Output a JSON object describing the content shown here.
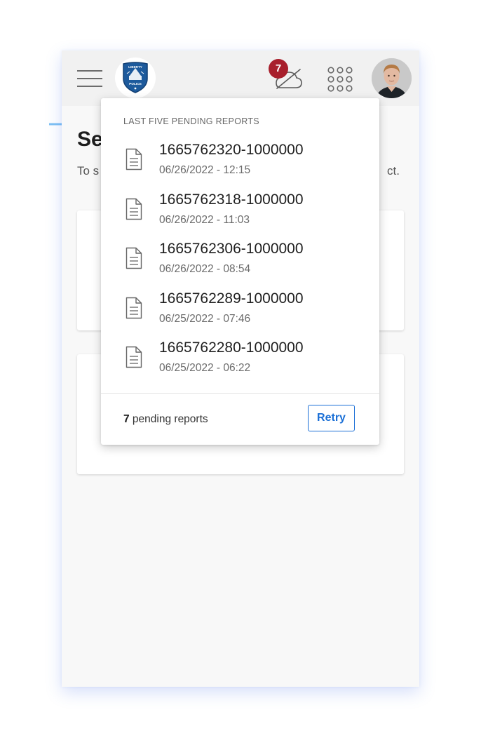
{
  "header": {
    "menu_icon": "hamburger-menu-icon",
    "logo": {
      "top_text": "LIBERTY",
      "bottom_text": "POLICE",
      "seal_colors": [
        "#1d5a9c",
        "#123f73"
      ]
    },
    "sync": {
      "icon": "cloud-off-icon",
      "badge_count": "7",
      "badge_color": "#a81f2c"
    },
    "apps_icon": "apps-grid-icon",
    "avatar_icon": "user-avatar"
  },
  "page": {
    "title": "Se",
    "subtitle_start": "To s",
    "subtitle_end": "ct."
  },
  "pending_dropdown": {
    "header": "LAST FIVE PENDING REPORTS",
    "reports": [
      {
        "id": "1665762320-1000000",
        "date": "06/26/2022 - 12:15"
      },
      {
        "id": "1665762318-1000000",
        "date": "06/26/2022 - 11:03"
      },
      {
        "id": "1665762306-1000000",
        "date": "06/26/2022 - 08:54"
      },
      {
        "id": "1665762289-1000000",
        "date": "06/25/2022 - 07:46"
      },
      {
        "id": "1665762280-1000000",
        "date": "06/25/2022 - 06:22"
      }
    ],
    "report_icon": "document-icon",
    "pending_count": "7",
    "pending_label": " pending reports",
    "retry_label": "Retry"
  },
  "colors": {
    "accent": "#1a6fd6",
    "badge": "#a81f2c",
    "callout_arrow": "#7fc1f3"
  }
}
